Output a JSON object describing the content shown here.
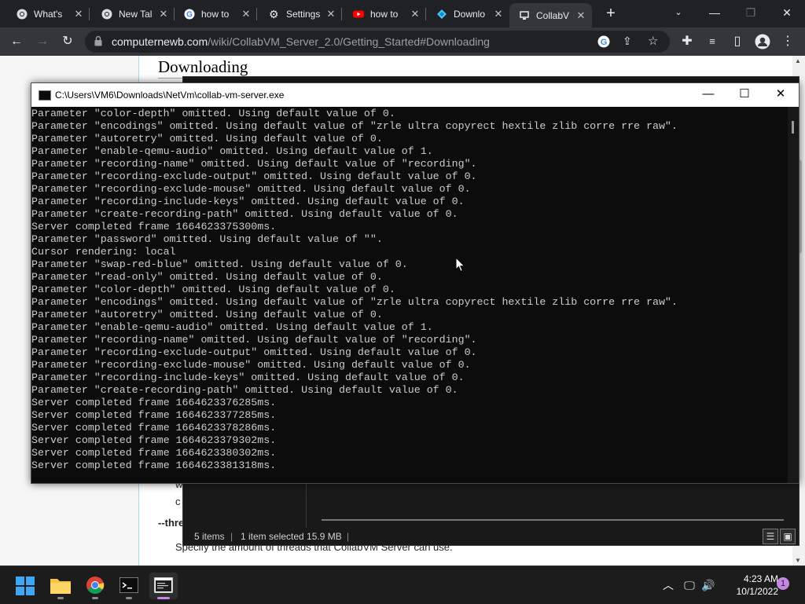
{
  "browser": {
    "tabs": [
      {
        "title": "What's",
        "icon": "chrome-icon"
      },
      {
        "title": "New Tal",
        "icon": "chrome-icon"
      },
      {
        "title": "how to",
        "icon": "google-icon"
      },
      {
        "title": "Settings",
        "icon": "gear-icon"
      },
      {
        "title": "how to",
        "icon": "youtube-icon"
      },
      {
        "title": "Downlo",
        "icon": "diamond-icon"
      },
      {
        "title": "CollabV",
        "icon": "collabvm-icon",
        "active": true
      }
    ],
    "url_host": "computernewb.com",
    "url_path": "/wiki/CollabVM_Server_2.0/Getting_Started#Downloading"
  },
  "page": {
    "heading": "Downloading",
    "frag1": "w",
    "frag2": "c",
    "option": "--thre",
    "description": "Specify the amount of threads that CollabVM Server can use."
  },
  "explorer": {
    "items_count": "5 items",
    "selection": "1 item selected  15.9 MB",
    "separator": "|"
  },
  "console": {
    "title": "C:\\Users\\VM6\\Downloads\\NetVm\\collab-vm-server.exe",
    "lines": [
      "Parameter \"color-depth\" omitted. Using default value of 0.",
      "Parameter \"encodings\" omitted. Using default value of \"zrle ultra copyrect hextile zlib corre rre raw\".",
      "Parameter \"autoretry\" omitted. Using default value of 0.",
      "Parameter \"enable-qemu-audio\" omitted. Using default value of 1.",
      "Parameter \"recording-name\" omitted. Using default value of \"recording\".",
      "Parameter \"recording-exclude-output\" omitted. Using default value of 0.",
      "Parameter \"recording-exclude-mouse\" omitted. Using default value of 0.",
      "Parameter \"recording-include-keys\" omitted. Using default value of 0.",
      "Parameter \"create-recording-path\" omitted. Using default value of 0.",
      "Server completed frame 1664623375300ms.",
      "Parameter \"password\" omitted. Using default value of \"\".",
      "Cursor rendering: local",
      "Parameter \"swap-red-blue\" omitted. Using default value of 0.",
      "Parameter \"read-only\" omitted. Using default value of 0.",
      "Parameter \"color-depth\" omitted. Using default value of 0.",
      "Parameter \"encodings\" omitted. Using default value of \"zrle ultra copyrect hextile zlib corre rre raw\".",
      "Parameter \"autoretry\" omitted. Using default value of 0.",
      "Parameter \"enable-qemu-audio\" omitted. Using default value of 1.",
      "Parameter \"recording-name\" omitted. Using default value of \"recording\".",
      "Parameter \"recording-exclude-output\" omitted. Using default value of 0.",
      "Parameter \"recording-exclude-mouse\" omitted. Using default value of 0.",
      "Parameter \"recording-include-keys\" omitted. Using default value of 0.",
      "Parameter \"create-recording-path\" omitted. Using default value of 0.",
      "Server completed frame 1664623376285ms.",
      "Server completed frame 1664623377285ms.",
      "Server completed frame 1664623378286ms.",
      "Server completed frame 1664623379302ms.",
      "Server completed frame 1664623380302ms.",
      "Server completed frame 1664623381318ms."
    ]
  },
  "taskbar": {
    "apps": [
      "start-icon",
      "file-explorer-icon",
      "chrome-icon",
      "terminal-icon",
      "collab-vm-server-icon"
    ],
    "time": "4:23 AM",
    "date": "10/1/2022",
    "notification_count": "1"
  },
  "colors": {
    "console_bg": "#0c0c0c",
    "console_text": "#cccccc",
    "chrome_dark": "#202124",
    "taskbar": "#1c1c1c",
    "accent": "#c587e3"
  }
}
